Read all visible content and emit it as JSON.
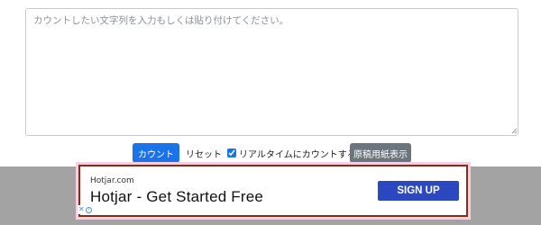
{
  "editor": {
    "placeholder": "カウントしたい文字列を入力もしくは貼り付けてください。",
    "value": ""
  },
  "controls": {
    "count_label": "カウント",
    "reset_label": "リセット",
    "realtime_label": "リアルタイムにカウントする",
    "realtime_checked": true,
    "genko_label": "原稿用紙表示"
  },
  "ad": {
    "domain": "Hotjar.com",
    "headline": "Hotjar - Get Started Free",
    "cta_label": "SIGN UP"
  },
  "colors": {
    "primary_button": "#1a73e8",
    "secondary_button": "#6c757d",
    "ad_cta": "#2b48c0",
    "ad_border": "#8b2a18",
    "ad_band": "#a3a3a3"
  }
}
